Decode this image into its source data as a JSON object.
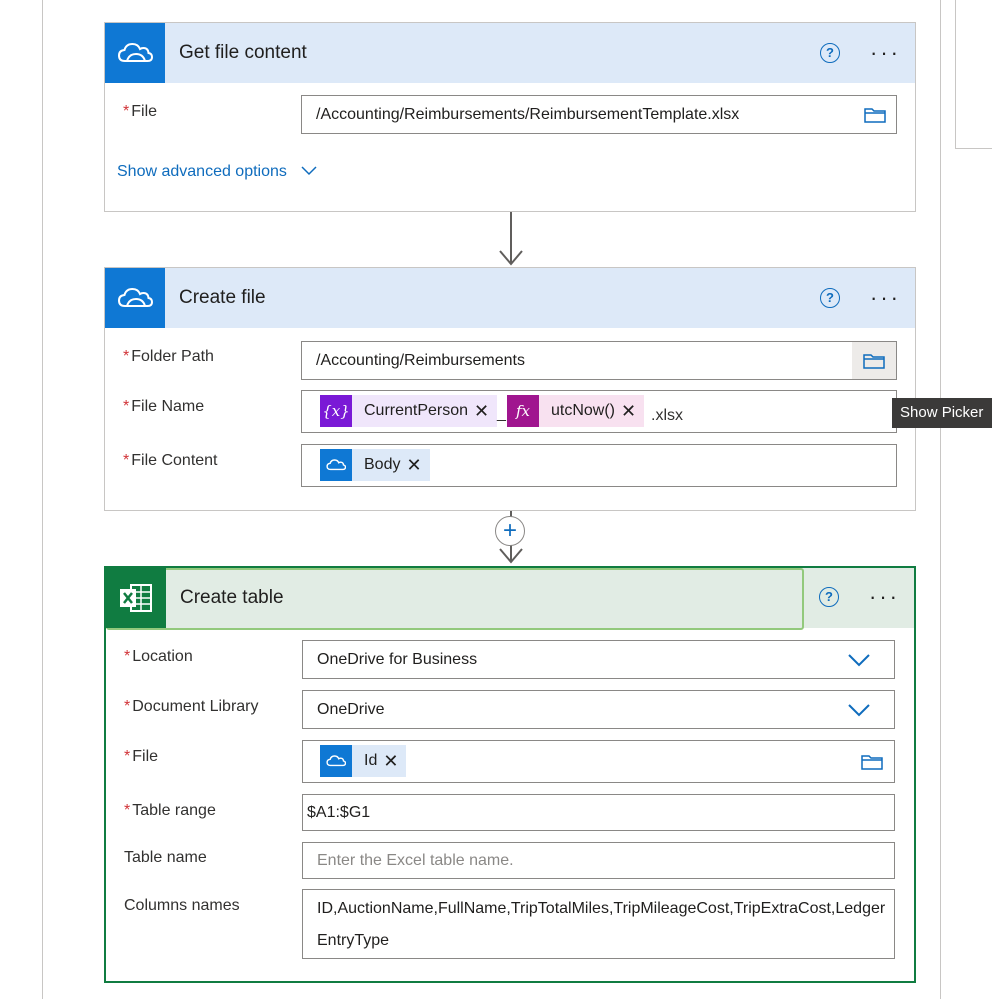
{
  "card1": {
    "title": "Get file content",
    "file_label": "File",
    "file_value": "/Accounting/Reimbursements/ReimbursementTemplate.xlsx",
    "advanced_link": "Show advanced options"
  },
  "card2": {
    "title": "Create file",
    "folder_label": "Folder Path",
    "folder_value": "/Accounting/Reimbursements",
    "filename_label": "File Name",
    "token_variable": "CurrentPerson",
    "separator": "_",
    "token_function": "utcNow()",
    "suffix": ".xlsx",
    "content_label": "File Content",
    "token_body": "Body"
  },
  "tooltip": "Show Picker",
  "card3": {
    "title": "Create table",
    "location_label": "Location",
    "location_value": "OneDrive for Business",
    "library_label": "Document Library",
    "library_value": "OneDrive",
    "file_label": "File",
    "file_token": "Id",
    "range_label": "Table range",
    "range_value": "$A1:$G1",
    "name_label": "Table name",
    "name_placeholder": "Enter the Excel table name.",
    "columns_label": "Columns names",
    "columns_line1": "ID,AuctionName,FullName,TripTotalMiles,TripMileageCost,TripExtraCost,Ledger",
    "columns_line2": "EntryType"
  },
  "icons": {
    "onedrive": "onedrive-cloud-icon",
    "excel": "excel-icon",
    "variable": "variable-icon",
    "function": "function-icon",
    "folder": "folder-icon",
    "help": "help-icon",
    "more": "more-options-icon",
    "chevron": "chevron-down-icon",
    "add": "add-step-icon"
  },
  "colors": {
    "onedrive_blue": "#0f78d4",
    "excel_green": "#107c41",
    "header_blue": "#dde9f8",
    "header_green": "#e1ece4",
    "variable_purple": "#7a19d6",
    "function_magenta": "#a0158f",
    "link_blue": "#0f6cbd"
  }
}
